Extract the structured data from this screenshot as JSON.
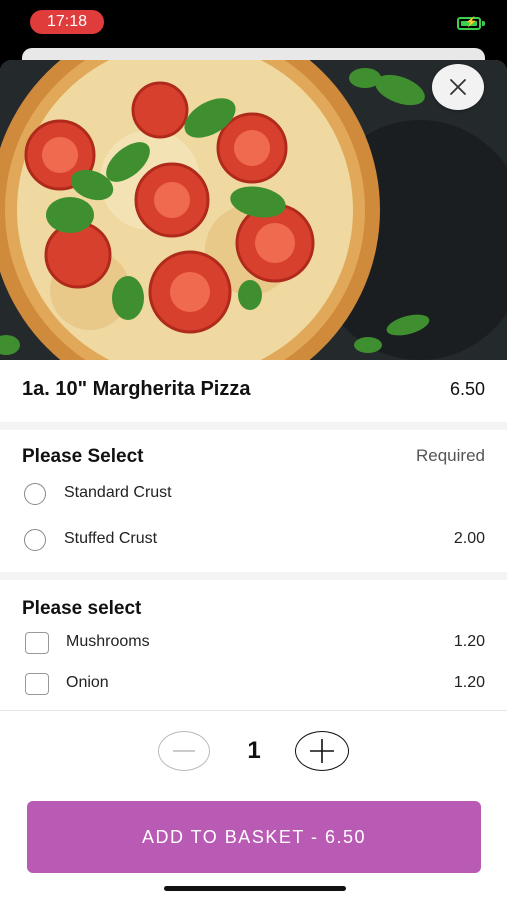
{
  "status_bar": {
    "time": "17:18"
  },
  "item": {
    "title": "1a. 10\" Margherita Pizza",
    "price": "6.50"
  },
  "sections": [
    {
      "title": "Please Select",
      "badge": "Required",
      "options": [
        {
          "label": "Standard Crust",
          "price": ""
        },
        {
          "label": "Stuffed Crust",
          "price": "2.00"
        }
      ]
    },
    {
      "title": "Please select",
      "options": [
        {
          "label": "Mushrooms",
          "price": "1.20"
        },
        {
          "label": "Onion",
          "price": "1.20"
        }
      ]
    }
  ],
  "quantity": "1",
  "add_button": {
    "label": "ADD TO BASKET  -  6.50"
  },
  "colors": {
    "accent": "#b95ab4",
    "time_pill": "#e03c3c",
    "battery": "#3ccf4e"
  },
  "icons": {
    "close": "close-icon",
    "minus": "minus-icon",
    "plus": "plus-icon",
    "battery": "battery-charging-icon"
  }
}
